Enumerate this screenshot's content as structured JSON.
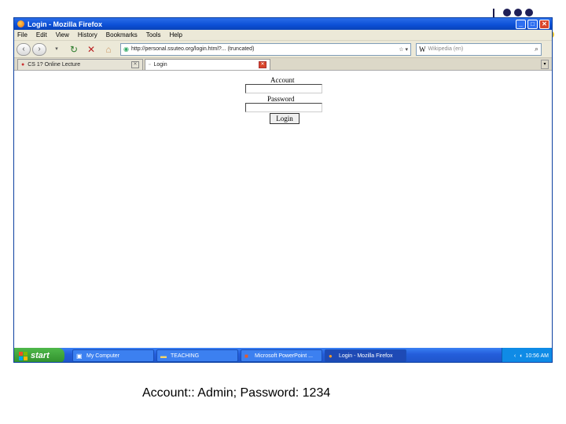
{
  "window": {
    "title": "Login - Mozilla Firefox",
    "buttons": {
      "minimize": "_",
      "maximize": "□",
      "close": "✕"
    }
  },
  "menu": [
    "File",
    "Edit",
    "View",
    "History",
    "Bookmarks",
    "Tools",
    "Help"
  ],
  "nav": {
    "url": "http://personal.ssuteo.org/login.html?... (truncated)",
    "search_placeholder": "Wikipedia (en)",
    "search_engine": "W"
  },
  "tabs": [
    {
      "label": "CS 1? Online Lecture",
      "active": false
    },
    {
      "label": "Login",
      "active": true
    }
  ],
  "login": {
    "account_label": "Account",
    "password_label": "Password",
    "button_label": "Login"
  },
  "taskbar": {
    "start": "start",
    "tasks": [
      {
        "label": "My Computer",
        "icon": "computer-icon",
        "active": false
      },
      {
        "label": "TEACHING",
        "icon": "folder-icon",
        "active": false
      },
      {
        "label": "Microsoft PowerPoint ...",
        "icon": "powerpoint-icon",
        "active": false
      },
      {
        "label": "Login - Mozilla Firefox",
        "icon": "firefox-icon",
        "active": true
      }
    ],
    "clock": "10:56 AM"
  },
  "caption": "Account:: Admin; Password: 1234",
  "colors": {
    "titlebar": "#0b4fd6",
    "taskbar": "#245edb",
    "start": "#2f8f2b",
    "deco_dots": "#1f1f57"
  }
}
